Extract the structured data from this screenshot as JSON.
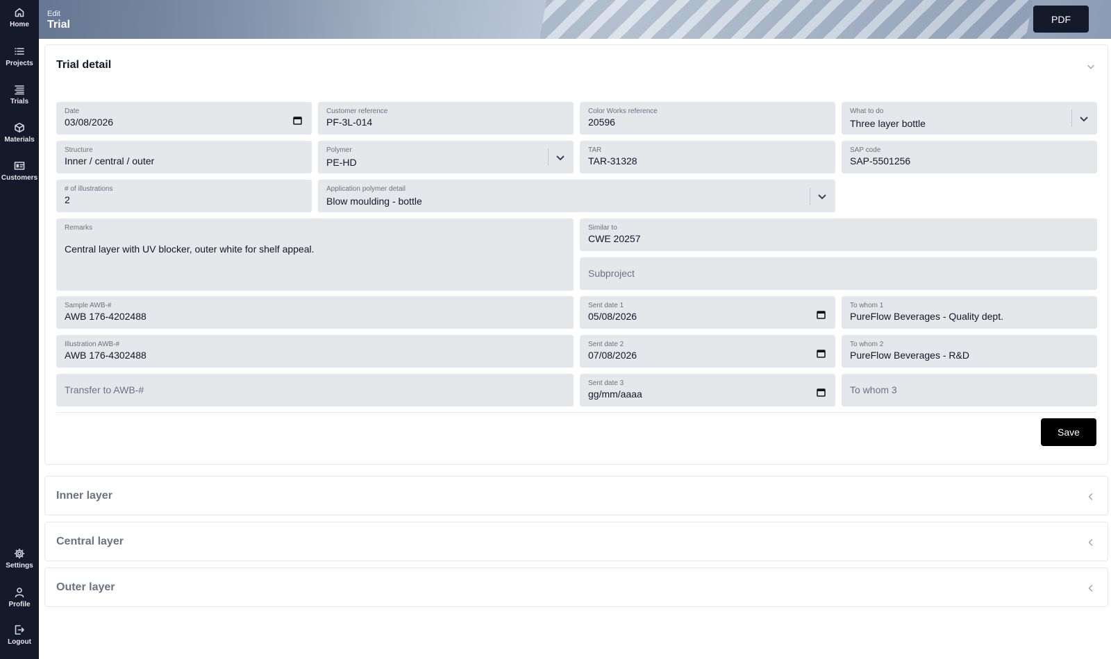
{
  "sidebar": {
    "top_items": [
      {
        "label": "Home",
        "icon": "home-icon"
      },
      {
        "label": "Projects",
        "icon": "list-icon"
      },
      {
        "label": "Trials",
        "icon": "list-detailed-icon"
      },
      {
        "label": "Materials",
        "icon": "cube-icon"
      },
      {
        "label": "Customers",
        "icon": "id-card-icon"
      }
    ],
    "bottom_items": [
      {
        "label": "Settings",
        "icon": "gear-icon"
      },
      {
        "label": "Profile",
        "icon": "user-icon"
      },
      {
        "label": "Logout",
        "icon": "logout-icon"
      }
    ]
  },
  "header": {
    "breadcrumb": "Edit",
    "title": "Trial",
    "pdf_label": "PDF"
  },
  "trial_detail": {
    "title": "Trial detail",
    "date": {
      "label": "Date",
      "value": "03/08/2026"
    },
    "customer_reference": {
      "label": "Customer reference",
      "value": "PF-3L-014"
    },
    "color_works_reference": {
      "label": "Color Works reference",
      "value": "20596"
    },
    "what_to_do": {
      "label": "What to do",
      "value": "Three layer bottle"
    },
    "structure": {
      "label": "Structure",
      "value": "Inner / central / outer"
    },
    "polymer": {
      "label": "Polymer",
      "value": "PE-HD"
    },
    "tar": {
      "label": "TAR",
      "value": "TAR-31328"
    },
    "sap_code": {
      "label": "SAP code",
      "value": "SAP-5501256"
    },
    "num_illustrations": {
      "label": "# of illustrations",
      "value": "2"
    },
    "application_polymer_detail": {
      "label": "Application polymer detail",
      "value": "Blow moulding - bottle"
    },
    "remarks": {
      "label": "Remarks",
      "value": "Central layer with UV blocker, outer white for shelf appeal."
    },
    "similar_to": {
      "label": "Similar to",
      "value": "CWE 20257"
    },
    "subproject": {
      "placeholder": "Subproject"
    },
    "sample_awb": {
      "label": "Sample AWB-#",
      "value": "AWB 176-4202488"
    },
    "sent_date_1": {
      "label": "Sent date 1",
      "value": "05/08/2026"
    },
    "to_whom_1": {
      "label": "To whom 1",
      "value": "PureFlow Beverages - Quality dept."
    },
    "illustration_awb": {
      "label": "Illustration AWB-#",
      "value": "AWB 176-4302488"
    },
    "sent_date_2": {
      "label": "Sent date 2",
      "value": "07/08/2026"
    },
    "to_whom_2": {
      "label": "To whom 2",
      "value": "PureFlow Beverages - R&D"
    },
    "transfer_awb": {
      "placeholder": "Transfer to AWB-#"
    },
    "sent_date_3": {
      "label": "Sent date 3",
      "value": "gg/mm/aaaa"
    },
    "to_whom_3": {
      "placeholder": "To whom 3"
    },
    "save_label": "Save"
  },
  "sections": [
    {
      "title": "Inner layer"
    },
    {
      "title": "Central layer"
    },
    {
      "title": "Outer layer"
    }
  ],
  "colors": {
    "sidebar_bg": "#141a2a",
    "field_bg": "#e5e7eb",
    "save_button": "#000000"
  }
}
